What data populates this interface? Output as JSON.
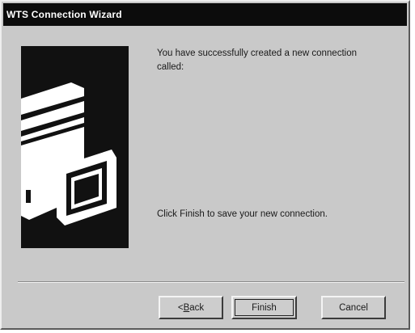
{
  "window": {
    "title": "WTS Connection Wizard"
  },
  "content": {
    "message_top": "You have successfully created a new connection called:",
    "message_bottom": "Click Finish to save your new connection."
  },
  "buttons": {
    "back_prefix": "<",
    "back_accel": "B",
    "back_rest": "ack",
    "finish": "Finish",
    "cancel": "Cancel"
  },
  "illustration": {
    "icon": "computer-with-monitor-icon"
  }
}
